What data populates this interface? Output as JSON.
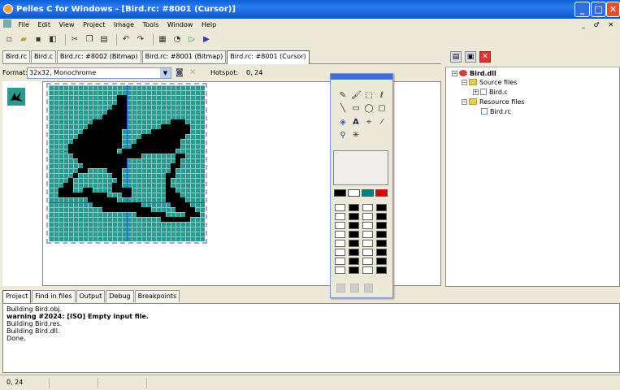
{
  "window": {
    "title": "Pelles C for Windows - [Bird.rc: #8001 (Cursor)]",
    "minimize": "_",
    "maximize": "□",
    "close": "✕"
  },
  "menu": [
    "File",
    "Edit",
    "View",
    "Project",
    "Image",
    "Tools",
    "Window",
    "Help"
  ],
  "mdi_controls": "_ ♂ ✕",
  "tabs": [
    "Bird.rc",
    "Bird.c",
    "Bird.rc: #8002 (Bitmap)",
    "Bird.rc: #8001 (Bitmap)",
    "Bird.rc: #8001 (Cursor)"
  ],
  "format": {
    "label": "Format:",
    "value": "32x32, Monochrome",
    "hotspot_label": "Hotspot:",
    "hotspot_value": "0, 24"
  },
  "palette_colors": {
    "black": "#000000",
    "white": "#ffffff",
    "teal": "#008080",
    "red": "#ff0000"
  },
  "project_tree": {
    "root": "Bird.dll",
    "source_folder": "Source files",
    "source_file": "Bird.c",
    "resource_folder": "Resource files",
    "resource_file": "Bird.rc"
  },
  "output_tabs": [
    "Project",
    "Find in files",
    "Output",
    "Debug",
    "Breakpoints"
  ],
  "output_lines": [
    "Building Bird.obj.",
    "warning #2024: [ISO] Empty input file.",
    "Building Bird.res.",
    "Building Bird.dll.",
    "Done."
  ],
  "status": {
    "position": "0, 24"
  }
}
